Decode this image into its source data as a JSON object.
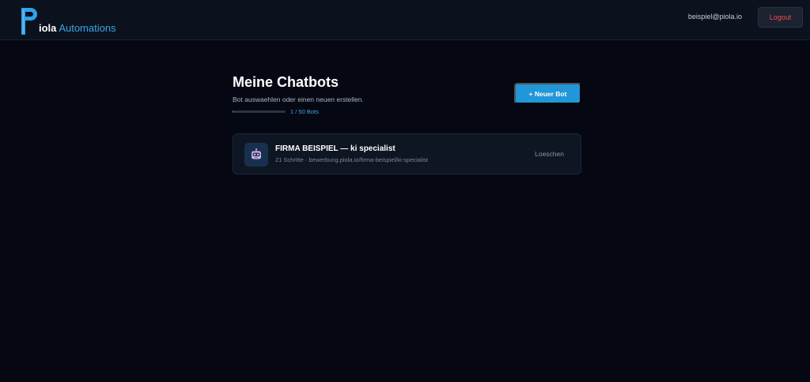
{
  "header": {
    "logo": {
      "letter": "P",
      "text_bold": "iola",
      "text_accent": "Automations"
    },
    "user_email": "beispiel@piola.io",
    "logout_label": "Logout"
  },
  "main": {
    "title": "Meine Chatbots",
    "subtitle": "Bot auswaehlen oder einen neuen erstellen.",
    "quota": {
      "used": 1,
      "max": 50,
      "label": "1 / 50 Bots"
    },
    "new_bot_label": "+ Neuer Bot",
    "bots": [
      {
        "name": "FIRMA BEISPIEL — ki specialist",
        "meta": "21 Schritte · bewerbung.piola.io/firma-beispiel/ki-specialist",
        "delete_label": "Loeschen",
        "icon": "robot-icon"
      }
    ]
  },
  "colors": {
    "background": "#050813",
    "topbar": "#0b111d",
    "accent": "#2196d8",
    "danger": "#ea4d4d"
  }
}
